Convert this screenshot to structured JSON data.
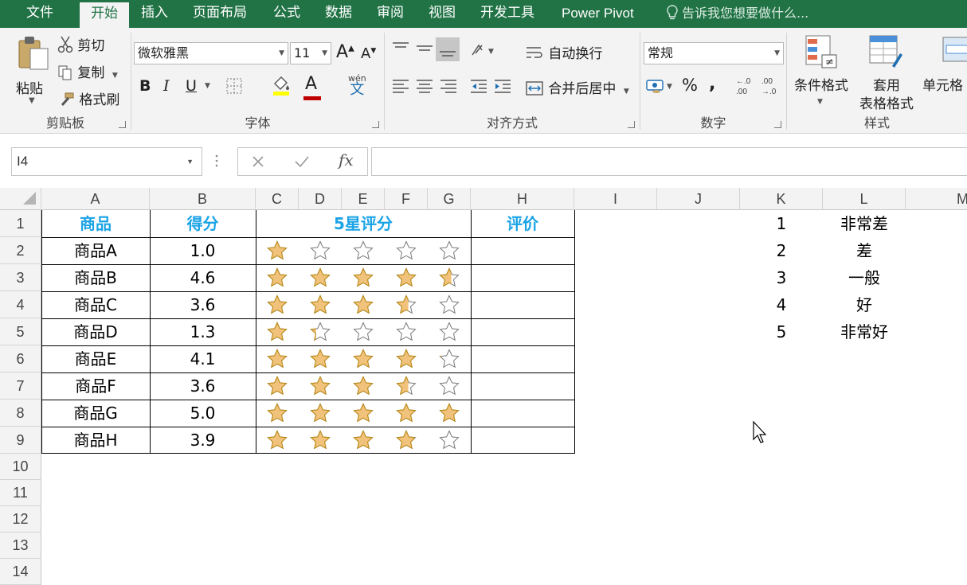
{
  "tabs": [
    {
      "label": "文件",
      "active": false
    },
    {
      "label": "开始",
      "active": true
    },
    {
      "label": "插入",
      "active": false
    },
    {
      "label": "页面布局",
      "active": false
    },
    {
      "label": "公式",
      "active": false
    },
    {
      "label": "数据",
      "active": false
    },
    {
      "label": "审阅",
      "active": false
    },
    {
      "label": "视图",
      "active": false
    },
    {
      "label": "开发工具",
      "active": false
    },
    {
      "label": "Power Pivot",
      "active": false
    }
  ],
  "tell_me": "告诉我您想要做什么...",
  "ribbon": {
    "clipboard": {
      "label": "剪贴板",
      "paste": "粘贴",
      "cut": "剪切",
      "copy": "复制",
      "format_painter": "格式刷"
    },
    "font": {
      "label": "字体",
      "font_name": "微软雅黑",
      "font_size": "11",
      "bold": "B",
      "italic": "I",
      "underline": "U",
      "phonetic": "wén"
    },
    "alignment": {
      "label": "对齐方式",
      "wrap_text": "自动换行",
      "merge_center": "合并后居中"
    },
    "number": {
      "label": "数字",
      "format": "常规",
      "percent": "%",
      "comma": ","
    },
    "styles": {
      "label": "样式",
      "conditional": "条件格式",
      "table_line1": "套用",
      "table_line2": "表格格式",
      "cell_styles": "单元格"
    }
  },
  "name_box": "I4",
  "columns": [
    "A",
    "B",
    "C",
    "D",
    "E",
    "F",
    "G",
    "H",
    "I",
    "J",
    "K",
    "L",
    "M"
  ],
  "rows": [
    "1",
    "2",
    "3",
    "4",
    "5",
    "6",
    "7",
    "8",
    "9",
    "10",
    "11",
    "12",
    "13",
    "14"
  ],
  "table": {
    "headers": {
      "product": "商品",
      "score": "得分",
      "rating": "5星评分",
      "evaluation": "评价"
    },
    "items": [
      {
        "name": "商品A",
        "score": "1.0",
        "stars": 1.0
      },
      {
        "name": "商品B",
        "score": "4.6",
        "stars": 4.6
      },
      {
        "name": "商品C",
        "score": "3.6",
        "stars": 3.6
      },
      {
        "name": "商品D",
        "score": "1.3",
        "stars": 1.3
      },
      {
        "name": "商品E",
        "score": "4.1",
        "stars": 4.1
      },
      {
        "name": "商品F",
        "score": "3.6",
        "stars": 3.6
      },
      {
        "name": "商品G",
        "score": "5.0",
        "stars": 5.0
      },
      {
        "name": "商品H",
        "score": "3.9",
        "stars": 3.9
      }
    ]
  },
  "lookup": [
    {
      "k": "1",
      "l": "非常差"
    },
    {
      "k": "2",
      "l": "差"
    },
    {
      "k": "3",
      "l": "一般"
    },
    {
      "k": "4",
      "l": "好"
    },
    {
      "k": "5",
      "l": "非常好"
    }
  ],
  "colors": {
    "accent": "#217346",
    "header_text": "#1aa3e6",
    "star_fill": "#f0c27b",
    "star_stroke": "#b8860b"
  }
}
